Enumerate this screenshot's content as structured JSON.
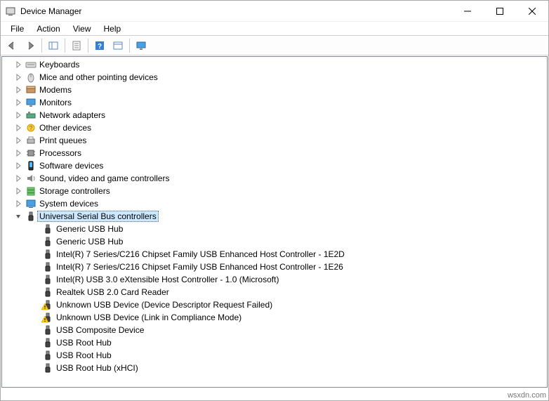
{
  "window": {
    "title": "Device Manager"
  },
  "menubar": {
    "file": "File",
    "action": "Action",
    "view": "View",
    "help": "Help"
  },
  "tree": {
    "categories": [
      {
        "icon": "keyboard-icon",
        "label": "Keyboards"
      },
      {
        "icon": "mouse-icon",
        "label": "Mice and other pointing devices"
      },
      {
        "icon": "modem-icon",
        "label": "Modems"
      },
      {
        "icon": "monitor-icon",
        "label": "Monitors"
      },
      {
        "icon": "network-icon",
        "label": "Network adapters"
      },
      {
        "icon": "other-icon",
        "label": "Other devices"
      },
      {
        "icon": "printer-icon",
        "label": "Print queues"
      },
      {
        "icon": "cpu-icon",
        "label": "Processors"
      },
      {
        "icon": "software-icon",
        "label": "Software devices"
      },
      {
        "icon": "sound-icon",
        "label": "Sound, video and game controllers"
      },
      {
        "icon": "storage-icon",
        "label": "Storage controllers"
      },
      {
        "icon": "system-icon",
        "label": "System devices"
      }
    ],
    "usb_category": {
      "icon": "usb-icon",
      "label": "Universal Serial Bus controllers"
    },
    "usb_children": [
      {
        "icon": "usb-icon",
        "warn": false,
        "label": "Generic USB Hub"
      },
      {
        "icon": "usb-icon",
        "warn": false,
        "label": "Generic USB Hub"
      },
      {
        "icon": "usb-icon",
        "warn": false,
        "label": "Intel(R) 7 Series/C216 Chipset Family USB Enhanced Host Controller - 1E2D"
      },
      {
        "icon": "usb-icon",
        "warn": false,
        "label": "Intel(R) 7 Series/C216 Chipset Family USB Enhanced Host Controller - 1E26"
      },
      {
        "icon": "usb-icon",
        "warn": false,
        "label": "Intel(R) USB 3.0 eXtensible Host Controller - 1.0 (Microsoft)"
      },
      {
        "icon": "usb-icon",
        "warn": false,
        "label": "Realtek USB 2.0 Card Reader"
      },
      {
        "icon": "usb-icon",
        "warn": true,
        "label": "Unknown USB Device (Device Descriptor Request Failed)"
      },
      {
        "icon": "usb-icon",
        "warn": true,
        "label": "Unknown USB Device (Link in Compliance Mode)"
      },
      {
        "icon": "usb-icon",
        "warn": false,
        "label": "USB Composite Device"
      },
      {
        "icon": "usb-icon",
        "warn": false,
        "label": "USB Root Hub"
      },
      {
        "icon": "usb-icon",
        "warn": false,
        "label": "USB Root Hub"
      },
      {
        "icon": "usb-icon",
        "warn": false,
        "label": "USB Root Hub (xHCI)"
      }
    ]
  },
  "watermark": "wsxdn.com"
}
